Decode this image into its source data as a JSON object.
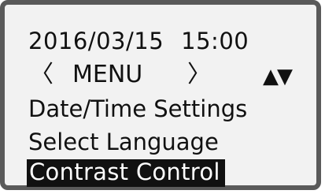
{
  "device_menu": {
    "date": "2016/03/15",
    "time": "15:00",
    "menu": {
      "left_bracket": "〈",
      "title": "MENU",
      "right_bracket": "〉",
      "scroll_indicator": "▲▼"
    },
    "items": [
      {
        "label": "Date/Time Settings",
        "selected": false
      },
      {
        "label": "Select Language",
        "selected": false
      },
      {
        "label": "Contrast Control",
        "selected": true
      }
    ]
  },
  "colors": {
    "frame_border": "#5a5a5a",
    "screen_bg": "#f2f2f2",
    "text": "#111111",
    "highlight_bg": "#111111",
    "highlight_text": "#ffffff"
  }
}
